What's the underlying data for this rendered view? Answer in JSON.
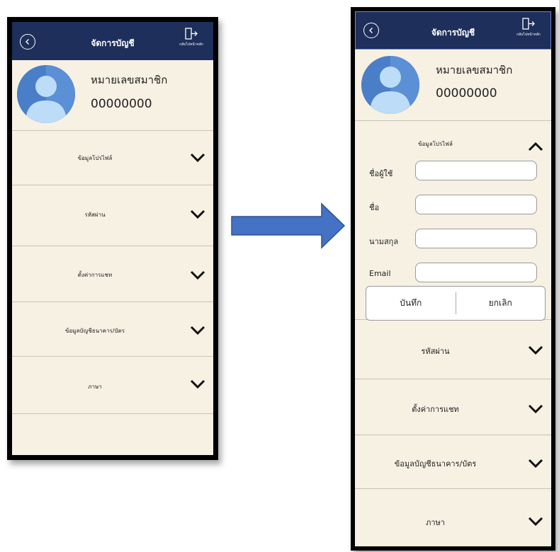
{
  "app": {
    "title": "จัดการบัญชี",
    "home_label": "กลับไปหน้าหลัก"
  },
  "profile": {
    "member_label": "หมายเลขสมาชิก",
    "member_number": "00000000"
  },
  "sections": {
    "profile_info": "ข้อมูลโปรไฟล์",
    "password": "รหัสผ่าน",
    "chat_settings": "ตั้งค่าการแชท",
    "bank_info": "ข้อมูลบัญชีธนาคาร/บัตร",
    "language": "ภาษา"
  },
  "form": {
    "username_label": "ชื่อผู้ใช้",
    "name_label": "ชื่อ",
    "surname_label": "นามสกุล",
    "email_label": "Email",
    "username_value": "",
    "name_value": "",
    "surname_value": "",
    "email_value": "",
    "save_label": "บันทึก",
    "cancel_label": "ยกเลิก"
  },
  "colors": {
    "appbar": "#1d2f5a",
    "background": "#f7f1e4",
    "arrow": "#4472c4"
  },
  "icons": {
    "back": "back-circle-icon",
    "home": "exit-door-icon",
    "chevron_down": "chevron-down-icon",
    "chevron_up": "chevron-up-icon"
  }
}
